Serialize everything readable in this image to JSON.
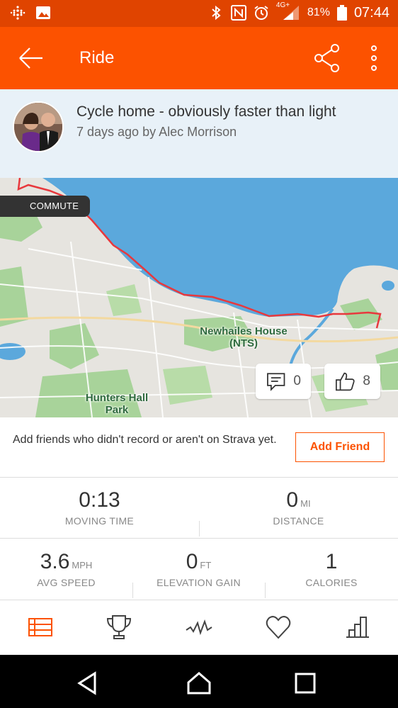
{
  "status_bar": {
    "battery": "81%",
    "network": "4G+",
    "time": "07:44",
    "icons": [
      "fitbit-icon",
      "gallery-icon",
      "bluetooth-icon",
      "nfc-icon",
      "alarm-icon",
      "signal-icon",
      "battery-icon"
    ]
  },
  "app_bar": {
    "title": "Ride",
    "color": "#fc5200"
  },
  "activity": {
    "title": "Cycle home - obviously faster than light",
    "subtitle": "7 days ago by Alec Morrison"
  },
  "map": {
    "badge": "COMMUTE",
    "labels": {
      "newhailes": "Newhailes House (NTS)",
      "hunters": "Hunters Hall Park"
    },
    "comments": "0",
    "kudos": "8"
  },
  "friend_prompt": {
    "text": "Add friends who didn't record or aren't on Strava yet.",
    "button": "Add Friend"
  },
  "stats": {
    "moving_time": {
      "value": "0:13",
      "unit": "",
      "label": "MOVING TIME"
    },
    "distance": {
      "value": "0",
      "unit": "MI",
      "label": "DISTANCE"
    },
    "avg_speed": {
      "value": "3.6",
      "unit": "MPH",
      "label": "AVG SPEED"
    },
    "elevation": {
      "value": "0",
      "unit": "FT",
      "label": "ELEVATION GAIN"
    },
    "calories": {
      "value": "1",
      "unit": "",
      "label": "CALORIES"
    }
  },
  "tabs": [
    "overview-icon",
    "trophy-icon",
    "analysis-icon",
    "heart-icon",
    "chart-icon"
  ],
  "nav": [
    "back-icon",
    "home-icon",
    "recents-icon"
  ]
}
